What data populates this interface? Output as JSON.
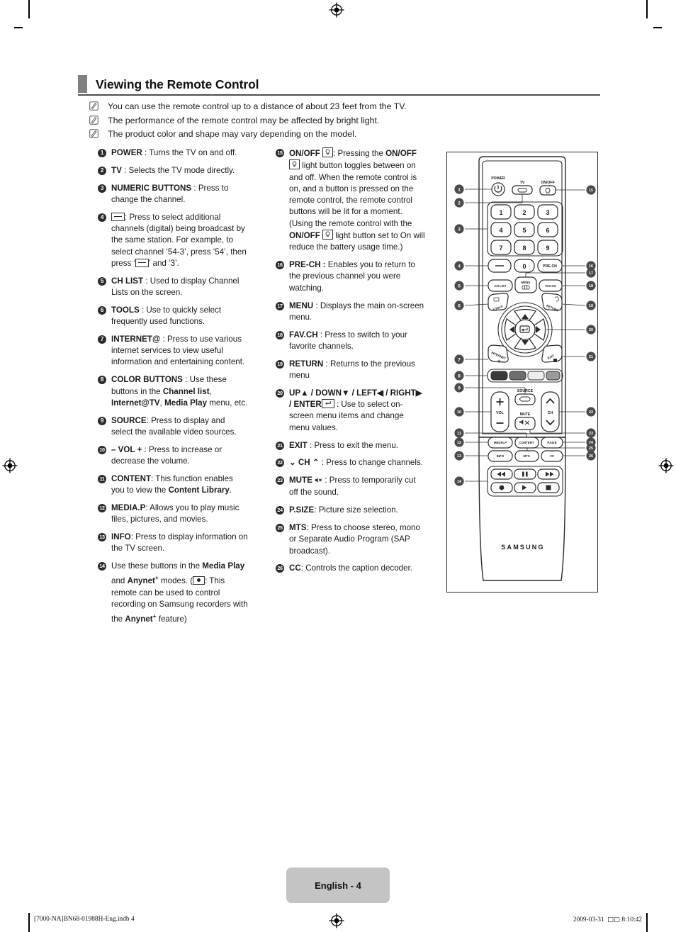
{
  "page": {
    "heading": "Viewing the Remote Control",
    "footer_badge": "English - 4",
    "footer_left": "[7000-NA]BN68-01988H-Eng.indb   4",
    "footer_right_date": "2009-03-31",
    "footer_right_tofu": "□□",
    "footer_right_time": "8:10:42",
    "accent_color": "#808080",
    "rule_color": "#4d4d4d",
    "badge_color": "#c4c4c4"
  },
  "notes": [
    "You can use the remote control up to a distance of about 23 feet from the TV.",
    "The performance of the remote control may be affected by bright light.",
    "The product color and shape may vary depending on the model."
  ],
  "left_column": [
    {
      "num": "1",
      "label": "POWER",
      "sep": " : ",
      "body": "Turns the TV on and off."
    },
    {
      "num": "2",
      "label": "TV",
      "sep": " : ",
      "body": "Selects the TV mode directly."
    },
    {
      "num": "3",
      "label": "NUMERIC BUTTONS",
      "sep": " : ",
      "body": "Press to change the channel."
    },
    {
      "num": "4",
      "label": "",
      "sep": ": ",
      "body": "Press to select additional channels (digital) being broadcast by the same station. For example, to select channel ‘54-3’, press ‘54’, then press ‘",
      "body2": "’ and ‘3’.",
      "glyph": "dash-key-icon"
    },
    {
      "num": "5",
      "label": "CH LIST",
      "sep": " : ",
      "body": "Used to display Channel Lists on the screen."
    },
    {
      "num": "6",
      "label": "TOOLS",
      "sep": " : ",
      "body": "Use to quickly select frequently used functions."
    },
    {
      "num": "7",
      "label": "INTERNET@",
      "sep": " : ",
      "body": "Press to use various internet services to view useful information and entertaining content."
    },
    {
      "num": "8",
      "label": "COLOR BUTTONS",
      "sep": " : ",
      "body": "Use these buttons in the ",
      "bold1": "Channel list",
      "mid1": ", ",
      "bold2": "Internet@TV",
      "mid2": ", ",
      "bold3": "Media Play",
      "tail": " menu, etc."
    },
    {
      "num": "9",
      "label": "SOURCE",
      "sep": ": ",
      "body": "Press to display and select the available video sources."
    },
    {
      "num": "10",
      "label": "– VOL +",
      "sep": " : ",
      "body": "Press to increase or decrease the volume."
    },
    {
      "num": "11",
      "label": "CONTENT",
      "sep": ": ",
      "body": "This function enables you to view the ",
      "bold1": "Content Library",
      "tail": "."
    },
    {
      "num": "12",
      "label": "MEDIA.P",
      "sep": ": ",
      "body": "Allows you to play music files, pictures, and movies."
    },
    {
      "num": "13",
      "label": "INFO",
      "sep": ": ",
      "body": "Press to display information on the TV screen."
    },
    {
      "num": "14",
      "label": "",
      "sep": "",
      "body": "Use these buttons in the ",
      "bold1": "Media Play",
      "mid1": " and ",
      "bold2": "Anynet",
      "sup2": "+",
      "mid2": " modes. (",
      "glyph": "record-key-icon",
      "body2": ": This remote can be used to control recording on Samsung recorders with the ",
      "bold3": "Anynet",
      "sup3": "+",
      "tail": " feature)"
    }
  ],
  "right_column": [
    {
      "num": "15",
      "label": "ON/OFF",
      "glyph": "light-bulb-key-icon",
      "sep": ": ",
      "body": "Pressing the ",
      "bold1": "ON/OFF",
      "glyph2": "light-bulb-key-icon",
      "body2": " light button toggles between on and off. When the remote control is on, and a button is pressed on the remote control, the remote control buttons will be lit for a moment. (Using the remote control with the ",
      "bold2": "ON/OFF",
      "glyph3": "light-bulb-key-icon",
      "tail": " light button set to On will reduce the battery usage time.)"
    },
    {
      "num": "16",
      "label": "PRE-CH :",
      "sep": " ",
      "body": "Enables you to return to the previous channel you were watching."
    },
    {
      "num": "17",
      "label": "MENU",
      "sep": " : ",
      "body": "Displays the main on-screen menu."
    },
    {
      "num": "18",
      "label": "FAV.CH",
      "sep": " : ",
      "body": "Press to switch to your favorite channels."
    },
    {
      "num": "19",
      "label": "RETURN",
      "sep": " : ",
      "body": "Returns to the previous menu"
    },
    {
      "num": "20",
      "label": "UP▲ / DOWN▼ / LEFT◀ / RIGHT▶ / ENTER",
      "glyph": "enter-key-icon",
      "sep": " : ",
      "body": "Use to select on-screen menu items and change menu values."
    },
    {
      "num": "21",
      "label": "EXIT",
      "sep": " : ",
      "body": "Press to exit the menu."
    },
    {
      "num": "22",
      "label": "⌄ CH ⌃",
      "sep": " : ",
      "body": "Press to change channels."
    },
    {
      "num": "23",
      "label": "MUTE",
      "glyph": "mute-icon",
      "sep": " : ",
      "body": "Press to temporarily cut off the sound."
    },
    {
      "num": "24",
      "label": "P.SIZE",
      "sep": ": ",
      "body": "Picture size selection."
    },
    {
      "num": "25",
      "label": "MTS",
      "sep": ": ",
      "body": "Press to choose stereo, mono or Separate Audio Program (SAP broadcast)."
    },
    {
      "num": "26",
      "label": "CC",
      "sep": ": ",
      "body": "Controls the caption decoder."
    }
  ],
  "remote": {
    "brand": "SAMSUNG",
    "labels": {
      "power": "POWER",
      "tv": "TV",
      "onoff": "ON/OFF",
      "prech": "PRE-CH",
      "chlist": "CH LIST",
      "menu": "MENU",
      "favch": "FAV.CH",
      "tools": "TOOLS",
      "return": "RETURN",
      "internet": "INTERNET@",
      "exit": "EXIT",
      "source": "SOURCE",
      "vol": "VOL",
      "mute": "MUTE",
      "ch": "CH",
      "mediap": "MEDIA.P",
      "content": "CONTENT",
      "psize": "P.SIZE",
      "info": "INFO",
      "mts": "MTS",
      "cc": "CC"
    },
    "numeric_keys": [
      "1",
      "2",
      "3",
      "4",
      "5",
      "6",
      "7",
      "8",
      "9",
      "0"
    ],
    "color_buttons": [
      "#3b3b3b",
      "#6e6e6e",
      "#ededed",
      "#9a9a9a"
    ],
    "callouts_left": [
      "1",
      "2",
      "3",
      "4",
      "5",
      "6",
      "7",
      "8",
      "9",
      "10",
      "11",
      "12",
      "13",
      "14"
    ],
    "callouts_right": [
      "15",
      "16",
      "17",
      "18",
      "19",
      "20",
      "21",
      "22",
      "23",
      "24",
      "25",
      "26"
    ]
  }
}
